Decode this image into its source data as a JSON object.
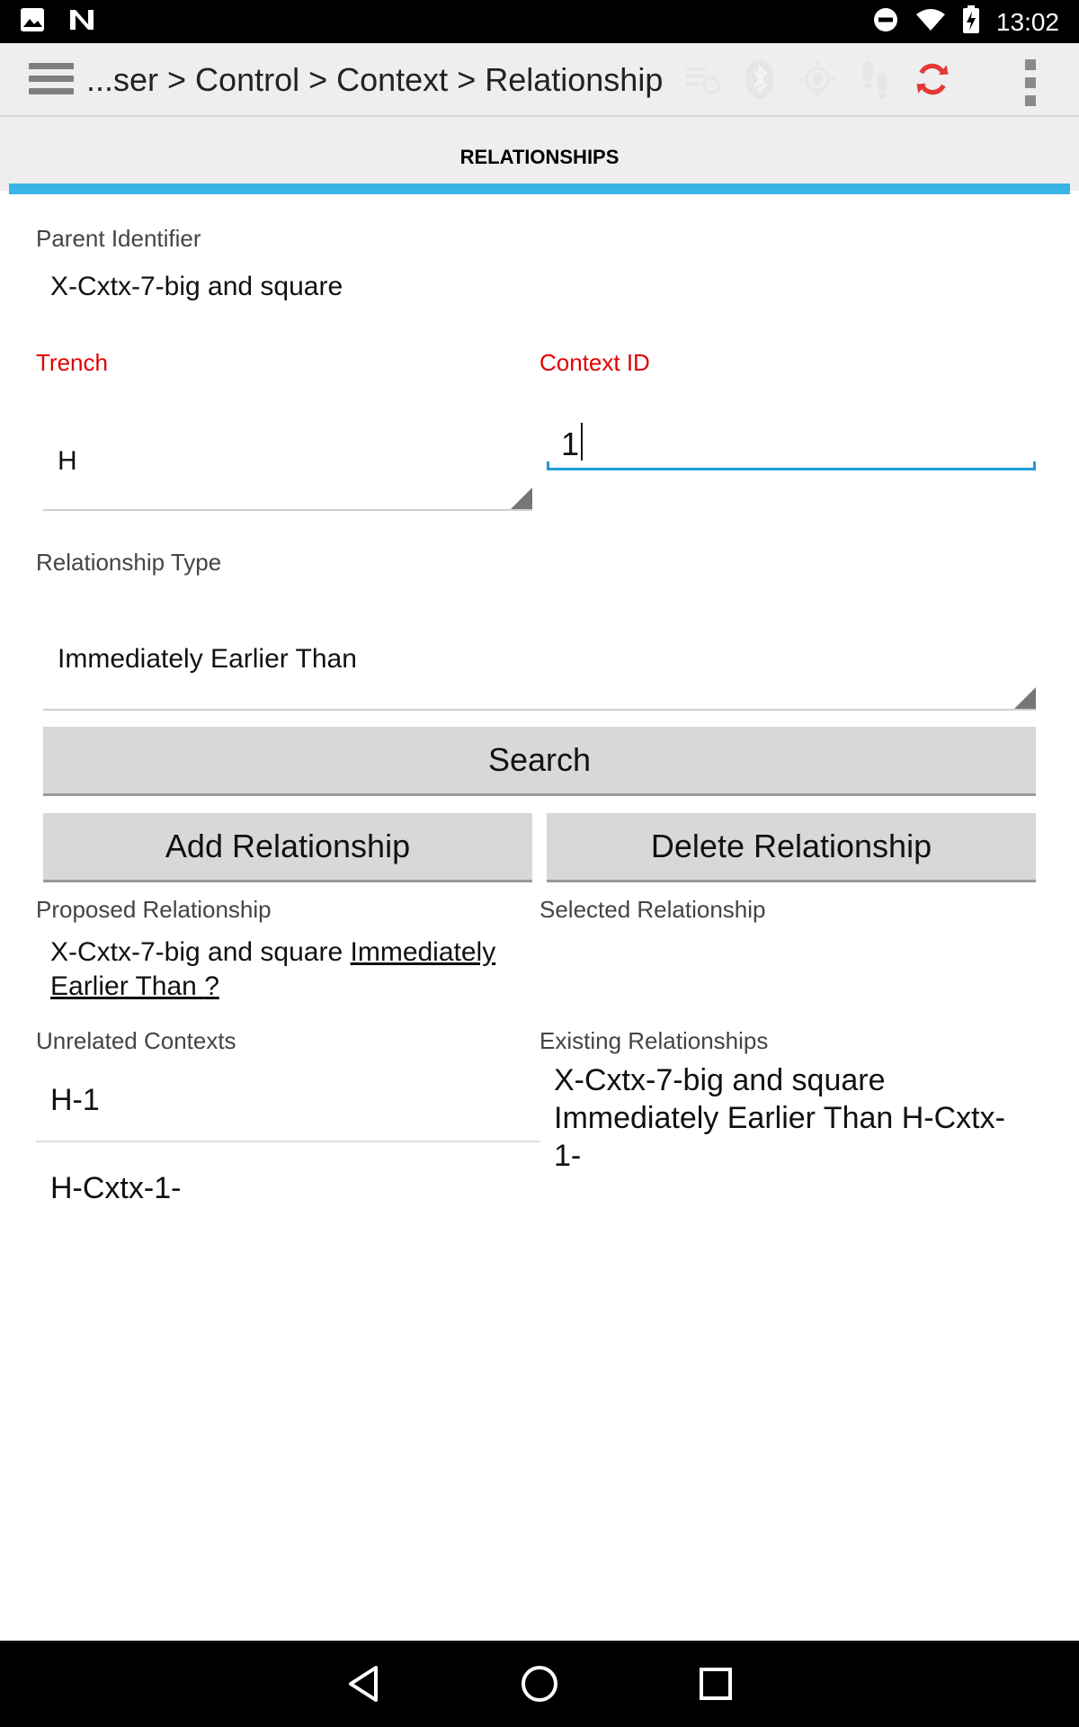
{
  "status_bar": {
    "time": "13:02",
    "icons": [
      "image-icon",
      "n-logo-icon",
      "do-not-disturb-icon",
      "wifi-icon",
      "battery-charging-icon"
    ]
  },
  "toolbar": {
    "breadcrumb": "...ser > Control > Context > Relationship",
    "icons": [
      "menu-icon",
      "sync-list-icon",
      "bluetooth-icon",
      "gps-icon",
      "footsteps-icon",
      "refresh-icon",
      "overflow-menu-icon"
    ],
    "refresh_color": "#e53935"
  },
  "tab": {
    "label": "RELATIONSHIPS",
    "indicator_color": "#3ab4e5"
  },
  "form": {
    "parent_identifier_label": "Parent Identifier",
    "parent_identifier_value": "X-Cxtx-7-big and square",
    "trench_label": "Trench",
    "trench_value": "H",
    "context_id_label": "Context ID",
    "context_id_value": "1",
    "relationship_type_label": "Relationship Type",
    "relationship_type_value": "Immediately Earlier Than",
    "required_color": "#e00000"
  },
  "buttons": {
    "search": "Search",
    "add": "Add Relationship",
    "delete": "Delete Relationship"
  },
  "proposed": {
    "label": "Proposed Relationship",
    "parent": "X-Cxtx-7-big and square ",
    "type": " Immediately Earlier Than ",
    "target": " ? "
  },
  "selected": {
    "label": "Selected Relationship"
  },
  "unrelated": {
    "label": "Unrelated Contexts",
    "items": [
      "H-1",
      "H-Cxtx-1-"
    ]
  },
  "existing": {
    "label": "Existing Relationships",
    "text": "X-Cxtx-7-big and square Immediately Earlier Than H-Cxtx-1-"
  },
  "nav_bar": {
    "icons": [
      "back-icon",
      "home-icon",
      "recents-icon"
    ]
  }
}
